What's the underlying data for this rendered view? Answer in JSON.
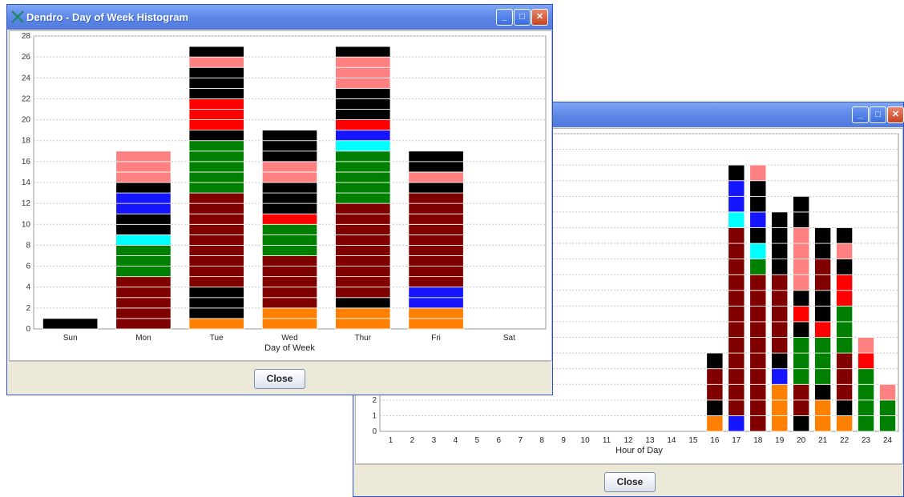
{
  "window1": {
    "title": "Dendro - Day of Week Histogram",
    "close_label": "Close",
    "chart_data": {
      "type": "bar",
      "stacked": true,
      "title": "",
      "xlabel": "Day of Week",
      "ylabel": "",
      "ylim": [
        0,
        28
      ],
      "y_ticks": [
        "0",
        "2",
        "4",
        "6",
        "8",
        "10",
        "12",
        "14",
        "16",
        "18",
        "20",
        "22",
        "24",
        "26",
        "28"
      ],
      "categories": [
        "Sun",
        "Mon",
        "Tue",
        "Wed",
        "Thur",
        "Fri",
        "Sat"
      ],
      "grid": true,
      "stacks": [
        [
          [
            "black",
            1
          ]
        ],
        [
          [
            "darkred",
            5
          ],
          [
            "green",
            3
          ],
          [
            "cyan",
            1
          ],
          [
            "black",
            2
          ],
          [
            "blue",
            2
          ],
          [
            "black",
            1
          ],
          [
            "pink",
            3
          ]
        ],
        [
          [
            "orange",
            1
          ],
          [
            "black",
            3
          ],
          [
            "darkred",
            9
          ],
          [
            "green",
            5
          ],
          [
            "black",
            1
          ],
          [
            "red",
            3
          ],
          [
            "black",
            3
          ],
          [
            "pink",
            1
          ],
          [
            "black",
            1
          ]
        ],
        [
          [
            "orange",
            2
          ],
          [
            "darkred",
            5
          ],
          [
            "green",
            3
          ],
          [
            "red",
            1
          ],
          [
            "black",
            3
          ],
          [
            "pink",
            2
          ],
          [
            "black",
            3
          ]
        ],
        [
          [
            "orange",
            2
          ],
          [
            "black",
            1
          ],
          [
            "darkred",
            9
          ],
          [
            "green",
            5
          ],
          [
            "cyan",
            1
          ],
          [
            "blue",
            1
          ],
          [
            "red",
            1
          ],
          [
            "black",
            3
          ],
          [
            "pink",
            3
          ],
          [
            "black",
            1
          ]
        ],
        [
          [
            "orange",
            2
          ],
          [
            "blue",
            2
          ],
          [
            "darkred",
            9
          ],
          [
            "black",
            1
          ],
          [
            "pink",
            1
          ],
          [
            "black",
            2
          ]
        ],
        []
      ]
    }
  },
  "window2": {
    "title": "",
    "close_label": "Close",
    "chart_data": {
      "type": "bar",
      "stacked": true,
      "title": "",
      "xlabel": "Hour of Day",
      "ylabel": "",
      "ylim": [
        0,
        19
      ],
      "y_ticks": [
        "0",
        "1",
        "2"
      ],
      "categories": [
        "1",
        "2",
        "3",
        "4",
        "5",
        "6",
        "7",
        "8",
        "9",
        "10",
        "11",
        "12",
        "13",
        "14",
        "15",
        "16",
        "17",
        "18",
        "19",
        "20",
        "21",
        "22",
        "23",
        "24"
      ],
      "grid": true,
      "stacks": [
        [],
        [],
        [],
        [],
        [],
        [],
        [],
        [],
        [],
        [],
        [],
        [],
        [],
        [],
        [],
        [
          [
            "orange",
            1
          ],
          [
            "black",
            1
          ],
          [
            "darkred",
            2
          ],
          [
            "black",
            1
          ]
        ],
        [
          [
            "blue",
            1
          ],
          [
            "darkred",
            12
          ],
          [
            "cyan",
            1
          ],
          [
            "blue",
            2
          ],
          [
            "black",
            1
          ]
        ],
        [
          [
            "darkred",
            10
          ],
          [
            "green",
            1
          ],
          [
            "cyan",
            1
          ],
          [
            "black",
            1
          ],
          [
            "blue",
            1
          ],
          [
            "black",
            2
          ],
          [
            "pink",
            1
          ]
        ],
        [
          [
            "orange",
            3
          ],
          [
            "blue",
            1
          ],
          [
            "black",
            1
          ],
          [
            "darkred",
            5
          ],
          [
            "black",
            4
          ]
        ],
        [
          [
            "black",
            1
          ],
          [
            "darkred",
            2
          ],
          [
            "green",
            3
          ],
          [
            "black",
            1
          ],
          [
            "red",
            1
          ],
          [
            "black",
            1
          ],
          [
            "pink",
            4
          ],
          [
            "black",
            2
          ]
        ],
        [
          [
            "orange",
            2
          ],
          [
            "black",
            1
          ],
          [
            "green",
            3
          ],
          [
            "red",
            1
          ],
          [
            "black",
            2
          ],
          [
            "darkred",
            2
          ],
          [
            "black",
            2
          ]
        ],
        [
          [
            "orange",
            1
          ],
          [
            "black",
            1
          ],
          [
            "darkred",
            3
          ],
          [
            "green",
            3
          ],
          [
            "red",
            2
          ],
          [
            "black",
            1
          ],
          [
            "pink",
            1
          ],
          [
            "black",
            1
          ]
        ],
        [
          [
            "green",
            4
          ],
          [
            "red",
            1
          ],
          [
            "pink",
            1
          ]
        ],
        [
          [
            "green",
            2
          ],
          [
            "pink",
            1
          ]
        ]
      ]
    }
  },
  "colors": {
    "black": "#000000",
    "darkred": "#800000",
    "green": "#008000",
    "cyan": "#00ffff",
    "blue": "#1515ff",
    "red": "#ff0000",
    "pink": "#ff8080",
    "orange": "#ff8000"
  }
}
